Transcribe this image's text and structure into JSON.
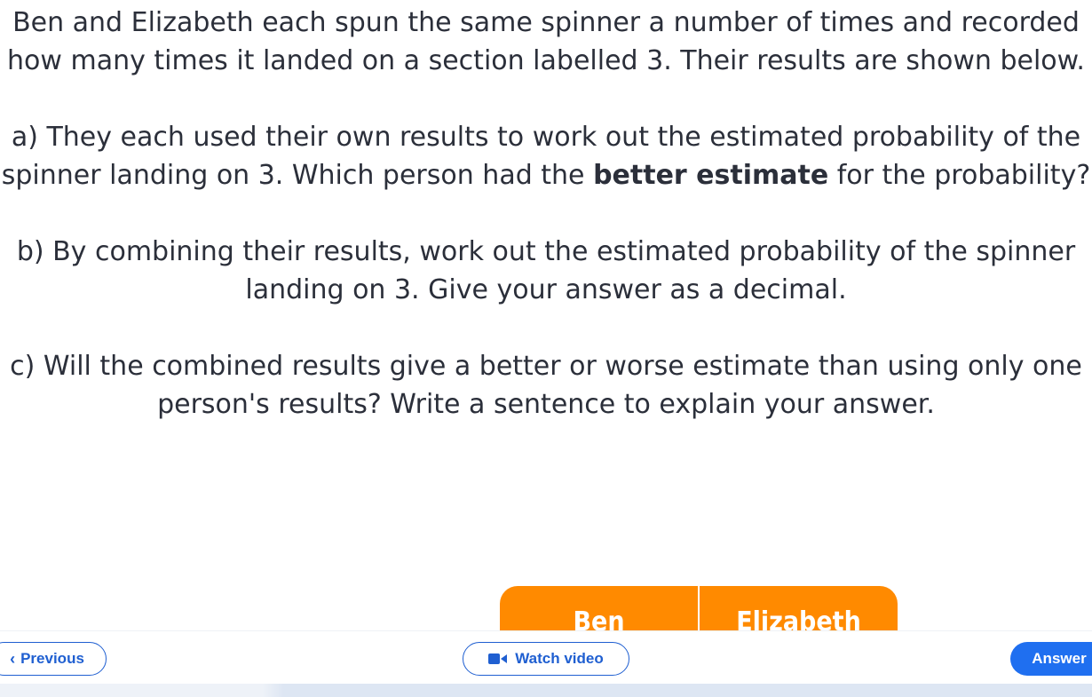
{
  "question": {
    "intro": "Ben and Elizabeth each spun the same spinner a number of times and recorded how many times it landed on a section labelled 3. Their results are shown below.",
    "part_a_pre": "a) They each used their own results to work out the estimated probability of the spinner landing on 3. Which person had the ",
    "part_a_bold": "better estimate",
    "part_a_post": " for the probability?",
    "part_b": "b) By combining their results, work out the estimated probability of the spinner landing on 3. Give your answer as a decimal.",
    "part_c": "c) Will the combined results give a better or worse estimate than using only one person's results? Write a sentence to explain your answer."
  },
  "table": {
    "headers": [
      "Ben",
      "Elizabeth"
    ]
  },
  "toolbar": {
    "previous_label": "Previous",
    "watch_label": "Watch video",
    "answer_label": "Answer"
  },
  "icons": {
    "previous": "chevron-left-icon",
    "watch": "video-camera-icon"
  },
  "colors": {
    "accent_blue": "#1f6ff0",
    "table_header": "#ff8a00"
  }
}
